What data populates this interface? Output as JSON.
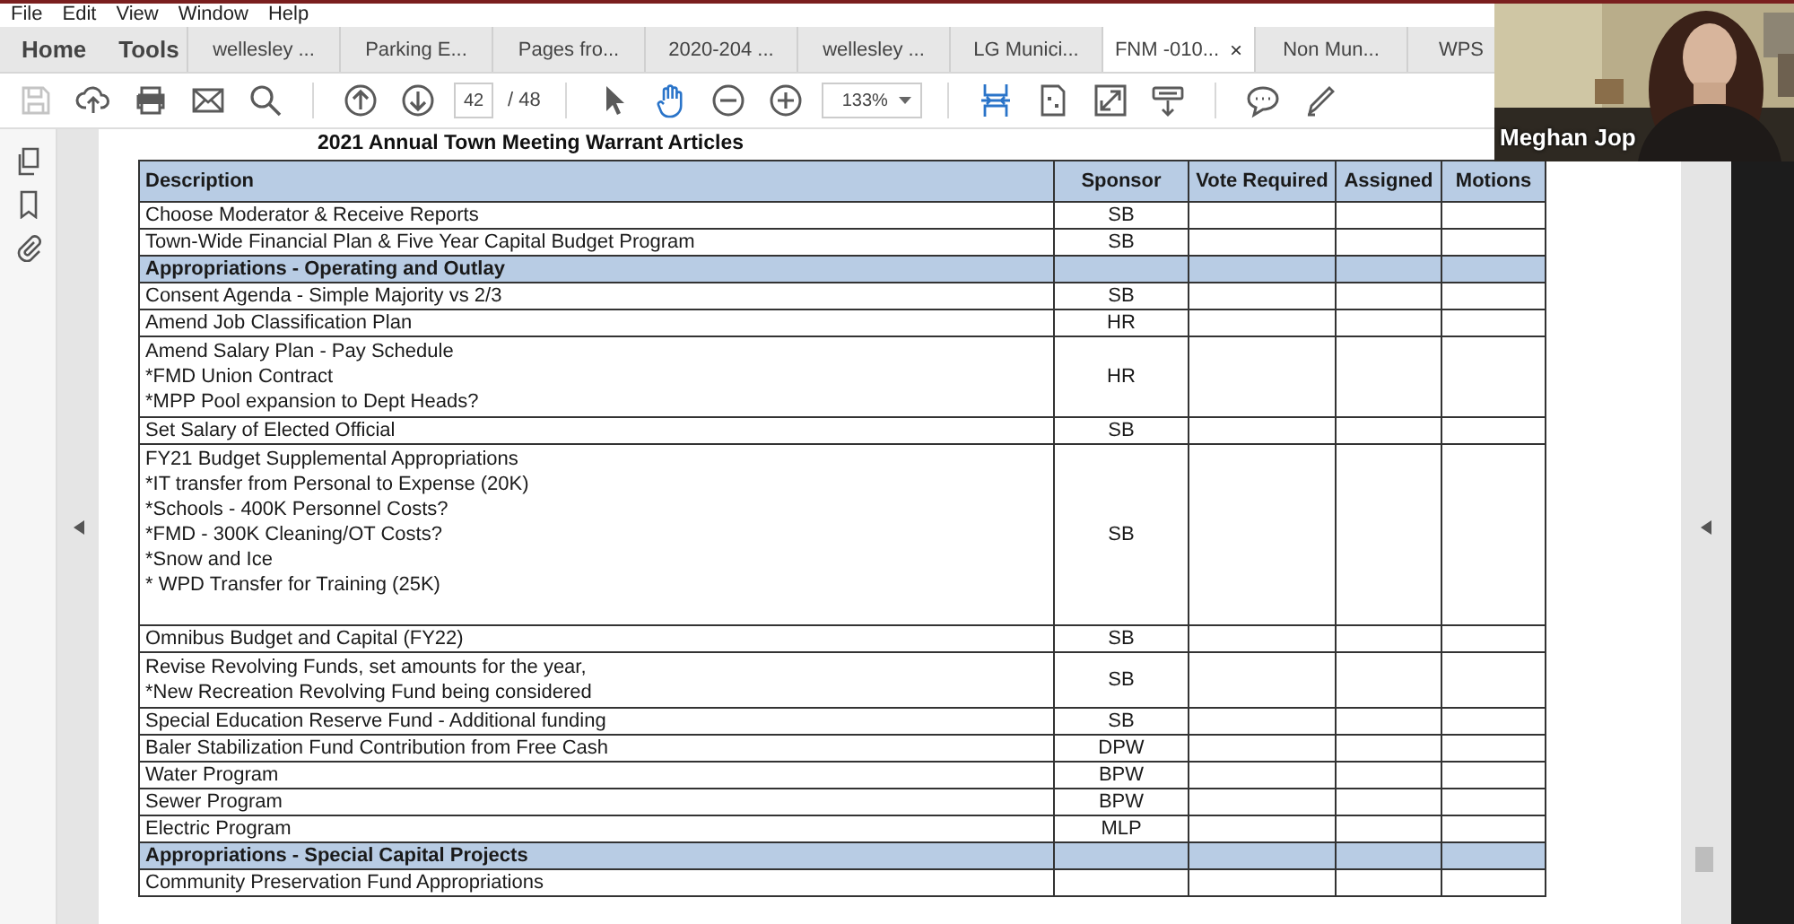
{
  "menu": [
    "File",
    "Edit",
    "View",
    "Window",
    "Help"
  ],
  "nav_tabs": [
    {
      "label": "Home"
    },
    {
      "label": "Tools"
    }
  ],
  "document_tabs": [
    {
      "label": "wellesley ...",
      "selected": false
    },
    {
      "label": "Parking E...",
      "selected": false
    },
    {
      "label": "Pages fro...",
      "selected": false
    },
    {
      "label": "2020-204 ...",
      "selected": false
    },
    {
      "label": "wellesley ...",
      "selected": false
    },
    {
      "label": "LG Munici...",
      "selected": false
    },
    {
      "label": "FNM -010...",
      "selected": true,
      "close": "×"
    },
    {
      "label": "Non Mun...",
      "selected": false
    },
    {
      "label": "WPS",
      "selected": false
    }
  ],
  "toolbar": {
    "items": [
      {
        "kind": "save",
        "selected": false,
        "disabled": true
      },
      {
        "kind": "upload",
        "selected": false,
        "disabled": false
      },
      {
        "kind": "print",
        "selected": false,
        "disabled": false
      },
      {
        "kind": "mail",
        "selected": false,
        "disabled": false
      },
      {
        "kind": "search",
        "selected": false,
        "disabled": false
      },
      {
        "kind": "separator"
      },
      {
        "kind": "prev_page",
        "selected": false,
        "disabled": false
      },
      {
        "kind": "next_page",
        "selected": false,
        "disabled": false
      },
      {
        "kind": "page_field",
        "value": "42"
      },
      {
        "kind": "page_total",
        "text": "/ 48"
      },
      {
        "kind": "separator"
      },
      {
        "kind": "select",
        "selected": false,
        "disabled": false
      },
      {
        "kind": "hand",
        "selected": true,
        "disabled": false
      },
      {
        "kind": "zoom_out",
        "selected": false,
        "disabled": false
      },
      {
        "kind": "zoom_in",
        "selected": false,
        "disabled": false
      },
      {
        "kind": "zoom_select",
        "value": "133%"
      },
      {
        "kind": "separator"
      },
      {
        "kind": "fit_page",
        "selected": true,
        "disabled": false
      },
      {
        "kind": "page_tool",
        "selected": false,
        "disabled": false
      },
      {
        "kind": "full_screen",
        "selected": false,
        "disabled": false
      },
      {
        "kind": "scroll_mode",
        "selected": false,
        "disabled": false
      },
      {
        "kind": "separator"
      },
      {
        "kind": "comment",
        "selected": false,
        "disabled": false
      },
      {
        "kind": "highlight",
        "selected": false,
        "disabled": false
      }
    ]
  },
  "document": {
    "title": "2021 Annual Town Meeting Warrant Articles",
    "columns": [
      "Description",
      "Sponsor",
      "Vote Required",
      "Assigned",
      "Motions"
    ],
    "rows": [
      {
        "kind": "item",
        "description": "Choose Moderator & Receive Reports",
        "sponsor": "SB"
      },
      {
        "kind": "item",
        "description": "Town-Wide Financial Plan & Five Year Capital Budget Program",
        "sponsor": "SB"
      },
      {
        "kind": "section",
        "description": "Appropriations - Operating and Outlay"
      },
      {
        "kind": "item",
        "description": "Consent Agenda - Simple Majority vs 2/3",
        "sponsor": "SB"
      },
      {
        "kind": "item",
        "description": "Amend Job Classification Plan",
        "sponsor": "HR"
      },
      {
        "kind": "item",
        "description": "Amend Salary Plan - Pay Schedule\n*FMD Union Contract\n*MPP Pool expansion to Dept Heads?",
        "sponsor": "HR"
      },
      {
        "kind": "item",
        "description": "Set Salary of Elected Official",
        "sponsor": "SB"
      },
      {
        "kind": "item",
        "description": "FY21 Budget Supplemental Appropriations\n*IT transfer from Personal to Expense (20K)\n*Schools - 400K Personnel Costs?\n*FMD - 300K Cleaning/OT Costs?\n*Snow and Ice\n* WPD Transfer for Training (25K)",
        "sponsor": "SB"
      },
      {
        "kind": "item",
        "description": "Omnibus Budget and Capital (FY22)",
        "sponsor": "SB"
      },
      {
        "kind": "item",
        "description": "Revise Revolving Funds, set amounts for the year,\n*New Recreation Revolving Fund being considered",
        "sponsor": "SB"
      },
      {
        "kind": "item",
        "description": "Special Education Reserve Fund - Additional funding",
        "sponsor": "SB"
      },
      {
        "kind": "item",
        "description": "Baler Stabilization Fund Contribution from Free Cash",
        "sponsor": "DPW"
      },
      {
        "kind": "item",
        "description": "Water Program",
        "sponsor": "BPW"
      },
      {
        "kind": "item",
        "description": "Sewer Program",
        "sponsor": "BPW"
      },
      {
        "kind": "item",
        "description": "Electric Program",
        "sponsor": "MLP"
      },
      {
        "kind": "section",
        "description": "Appropriations - Special Capital Projects"
      },
      {
        "kind": "item",
        "description": "Community Preservation Fund Appropriations",
        "sponsor": ""
      }
    ]
  },
  "webcam": {
    "kind": "picture",
    "name": "Meghan Jop"
  }
}
